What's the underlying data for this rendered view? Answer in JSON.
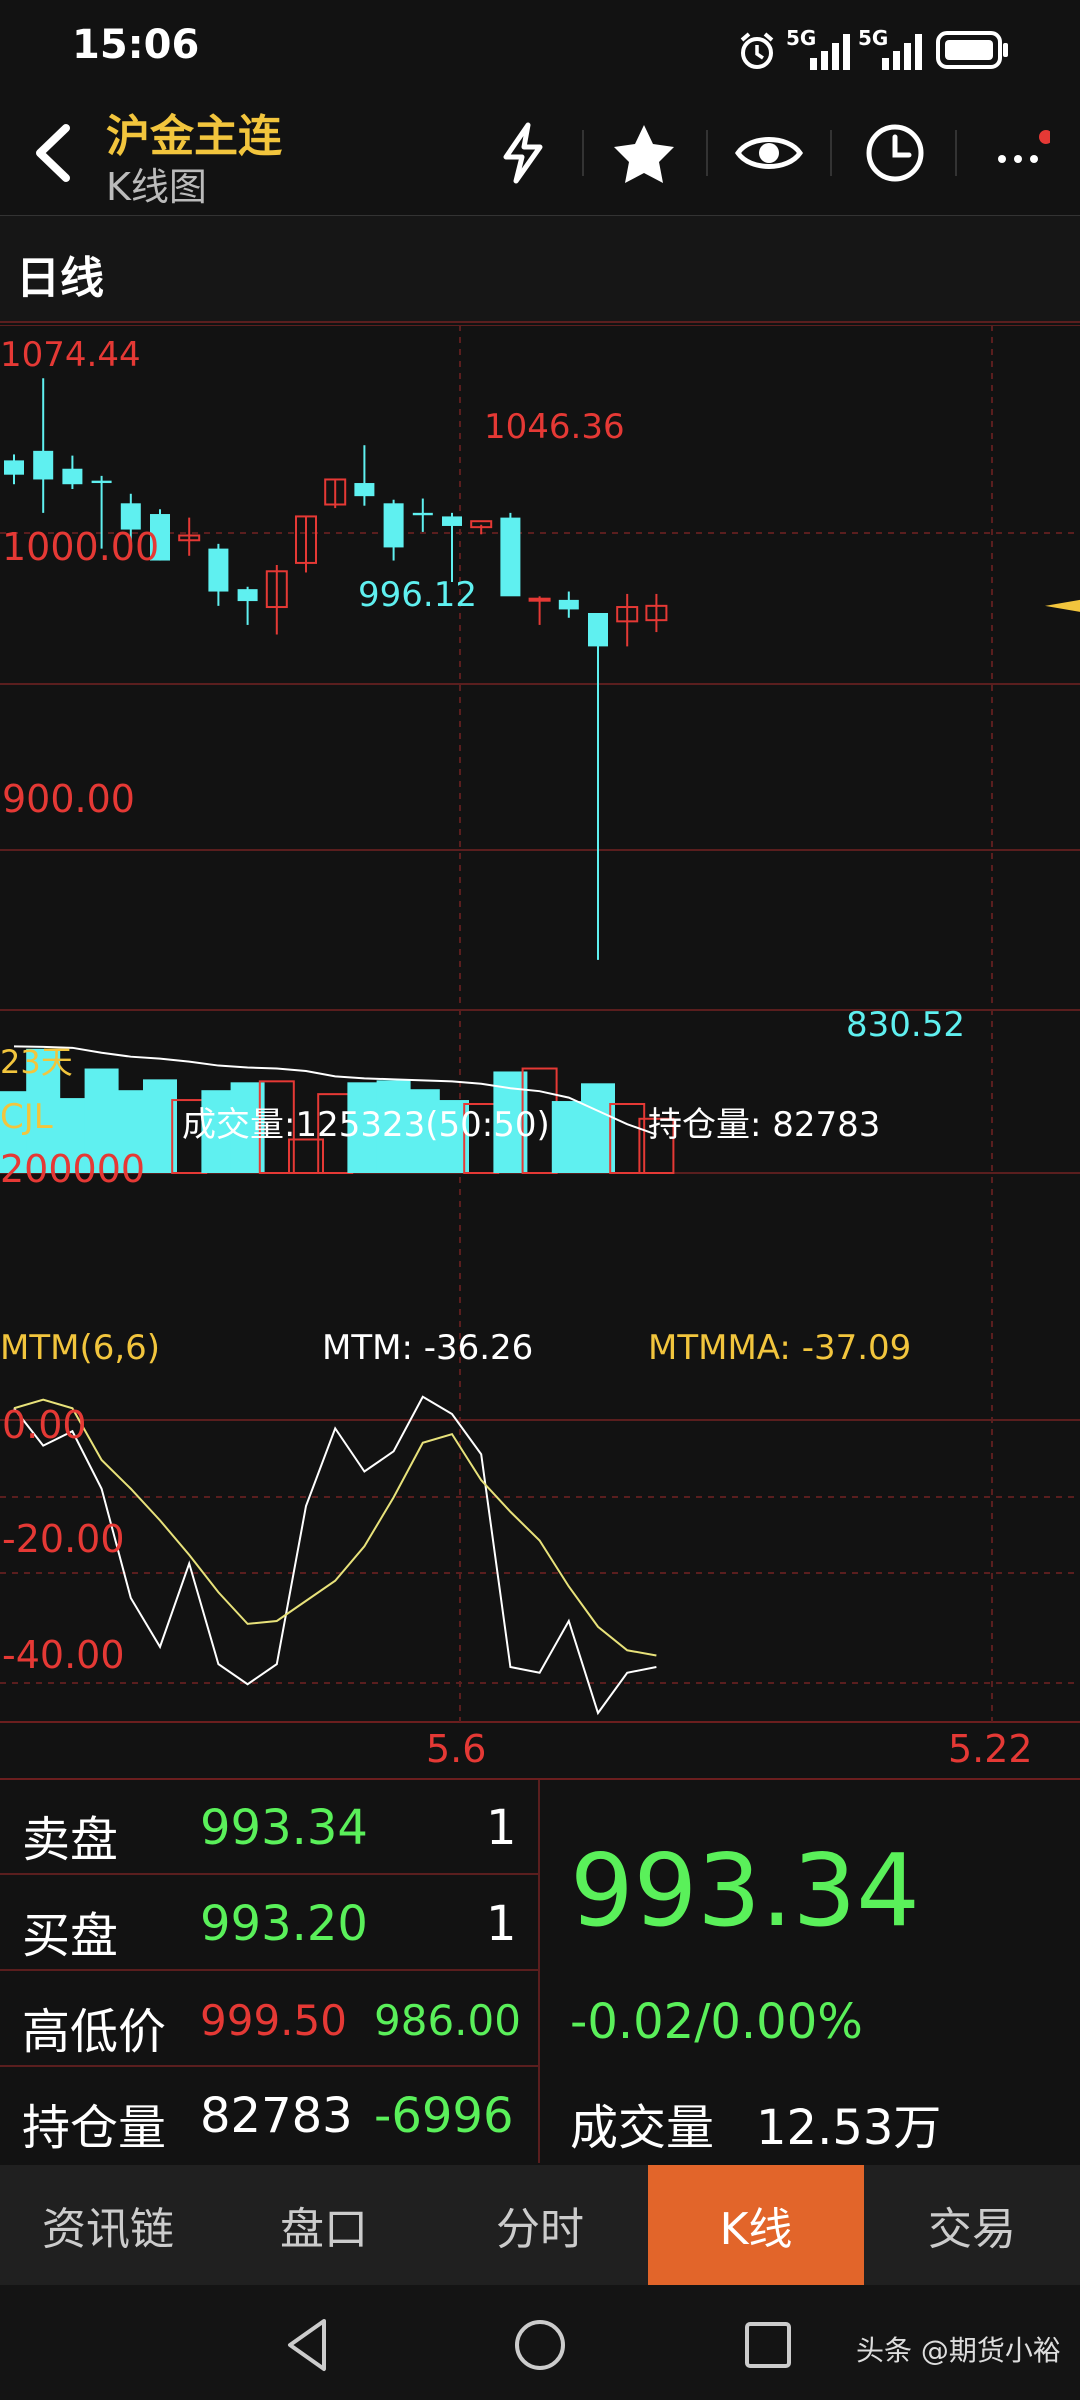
{
  "status_bar": {
    "time": "15:06",
    "signal1": "5G",
    "signal2": "5G"
  },
  "header": {
    "title": "沪金主连",
    "subtitle": "K线图"
  },
  "period_tab": "日线",
  "price_chart": {
    "y_labels": [
      "1000.00",
      "900.00"
    ],
    "annotations": {
      "high": "1074.44",
      "peak2": "1046.36",
      "low1": "996.12",
      "low2": "830.52"
    },
    "days_label": "23天"
  },
  "volume_chart": {
    "name": "CJL",
    "volume_label": "成交量:125323(50:50)",
    "oi_label": "持仓量: 82783",
    "y_label": "200000"
  },
  "mtm_chart": {
    "name": "MTM(6,6)",
    "mtm_label": "MTM: -36.26",
    "mtmma_label": "MTMMA: -37.09",
    "y_labels": [
      "0.00",
      "-20.00",
      "-40.00"
    ]
  },
  "x_axis": {
    "labels": [
      "5.6",
      "5.22"
    ]
  },
  "quote": {
    "sell": {
      "label": "卖盘",
      "price": "993.34",
      "qty": "1"
    },
    "buy": {
      "label": "买盘",
      "price": "993.20",
      "qty": "1"
    },
    "highlow": {
      "label": "高低价",
      "high": "999.50",
      "low": "986.00"
    },
    "oi": {
      "label": "持仓量",
      "value": "82783",
      "change": "-6996"
    },
    "last_price": "993.34",
    "change": "-0.02/0.00%",
    "volume": {
      "label": "成交量",
      "value": "12.53万"
    }
  },
  "bottom_tabs": [
    "资讯链",
    "盘口",
    "分时",
    "K线",
    "交易"
  ],
  "active_tab": "K线",
  "watermark": "头条 @期货小裕",
  "colors": {
    "up": "#e53935",
    "down": "#5ff0f0",
    "accent": "#f2c53d",
    "positive": "#5af05a",
    "active_tab": "#e2652a"
  },
  "chart_data": [
    {
      "type": "candlestick",
      "title": "",
      "ylabel": "",
      "ylim": [
        820,
        1080
      ],
      "candles": [
        {
          "o": 1040.0,
          "h": 1042.5,
          "l": 1030.0,
          "c": 1034.0
        },
        {
          "o": 1044.0,
          "h": 1074.44,
          "l": 1018.0,
          "c": 1032.0
        },
        {
          "o": 1036.5,
          "h": 1042.0,
          "l": 1028.0,
          "c": 1030.0
        },
        {
          "o": 1031.5,
          "h": 1033.5,
          "l": 1003.0,
          "c": 1030.5
        },
        {
          "o": 1022.0,
          "h": 1026.0,
          "l": 1004.0,
          "c": 1011.0
        },
        {
          "o": 1017.5,
          "h": 1019.5,
          "l": 998.0,
          "c": 998.0
        },
        {
          "o": 1006.5,
          "h": 1016.0,
          "l": 1000.0,
          "c": 1008.5
        },
        {
          "o": 1003.0,
          "h": 1005.0,
          "l": 979.0,
          "c": 985.0
        },
        {
          "o": 986.0,
          "h": 987.0,
          "l": 971.0,
          "c": 981.0
        },
        {
          "o": 978.5,
          "h": 996.12,
          "l": 967.0,
          "c": 993.5
        },
        {
          "o": 997.0,
          "h": 1016.5,
          "l": 993.0,
          "c": 1016.5
        },
        {
          "o": 1021.5,
          "h": 1032.0,
          "l": 1020.0,
          "c": 1032.0
        },
        {
          "o": 1030.5,
          "h": 1046.36,
          "l": 1021.0,
          "c": 1025.0
        },
        {
          "o": 1022.0,
          "h": 1023.5,
          "l": 998.0,
          "c": 1003.5
        },
        {
          "o": 1018.0,
          "h": 1024.0,
          "l": 1010.0,
          "c": 1017.0
        },
        {
          "o": 1016.5,
          "h": 1018.0,
          "l": 989.0,
          "c": 1012.5
        },
        {
          "o": 1012.0,
          "h": 1013.0,
          "l": 1009.0,
          "c": 1014.5
        },
        {
          "o": 1016.0,
          "h": 1018.0,
          "l": 985.0,
          "c": 983.0
        },
        {
          "o": 981.5,
          "h": 983.0,
          "l": 971.0,
          "c": 982.0
        },
        {
          "o": 981.5,
          "h": 985.0,
          "l": 974.0,
          "c": 977.5
        },
        {
          "o": 976.0,
          "h": 976.0,
          "l": 830.52,
          "c": 962.0
        },
        {
          "o": 972.5,
          "h": 984.0,
          "l": 962.0,
          "c": 978.5
        },
        {
          "o": 973.0,
          "h": 984.0,
          "l": 968.0,
          "c": 979.0
        }
      ]
    },
    {
      "type": "bar",
      "name": "CJL",
      "ylim": [
        0,
        280000
      ],
      "values": [
        166000,
        252000,
        152000,
        212000,
        168000,
        190000,
        148000,
        168000,
        184000,
        186000,
        68000,
        160000,
        184000,
        188000,
        170000,
        148000,
        140000,
        206000,
        212000,
        146000,
        182000,
        140000,
        110000
      ],
      "up_flags": [
        false,
        false,
        false,
        false,
        false,
        false,
        true,
        false,
        false,
        true,
        true,
        true,
        false,
        false,
        false,
        false,
        true,
        false,
        true,
        false,
        false,
        true,
        true
      ],
      "line": [
        257000,
        256000,
        254000,
        244000,
        236000,
        232000,
        226000,
        218000,
        214000,
        212000,
        207000,
        196000,
        192000,
        190000,
        188000,
        186000,
        181000,
        172000,
        166000,
        153000,
        126000,
        99000,
        78000
      ]
    },
    {
      "type": "line",
      "name": "MTM(6,6)",
      "ylim": [
        -45,
        10
      ],
      "series": [
        {
          "name": "MTM",
          "values": [
            5.0,
            -1.5,
            1.0,
            -9.0,
            -28.0,
            -36.5,
            -22.0,
            -39.5,
            -43.0,
            -39.5,
            -12.0,
            1.5,
            -6.0,
            -2.5,
            7.0,
            4.0,
            -3.0,
            -40.0,
            -41.0,
            -32.0,
            -48.0,
            -41.0,
            -40.0
          ]
        },
        {
          "name": "MTMMA",
          "values": [
            5.0,
            6.5,
            5.0,
            -4.0,
            -9.0,
            -14.5,
            -20.5,
            -27.0,
            -32.5,
            -32.0,
            -28.5,
            -25.0,
            -19.0,
            -10.5,
            -1.0,
            0.5,
            -7.5,
            -13.0,
            -18.0,
            -26.0,
            -33.0,
            -37.09,
            -38.0
          ]
        }
      ]
    }
  ]
}
